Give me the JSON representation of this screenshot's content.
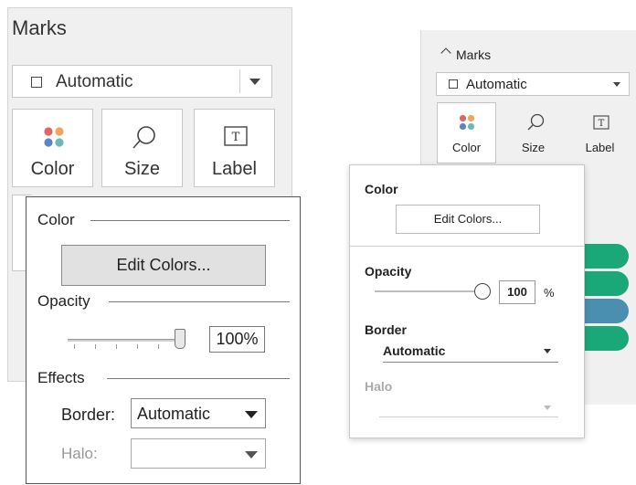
{
  "left": {
    "title": "Marks",
    "mark_type": "Automatic",
    "cards": [
      {
        "label": "Color",
        "icon": "color-dots-icon"
      },
      {
        "label": "Size",
        "icon": "size-lasso-icon"
      },
      {
        "label": "Label",
        "icon": "label-t-icon"
      }
    ],
    "popup": {
      "color_heading": "Color",
      "edit_colors": "Edit Colors...",
      "opacity_heading": "Opacity",
      "opacity_value": "100%",
      "opacity_level": 1.0,
      "effects_heading": "Effects",
      "border_label": "Border:",
      "border_value": "Automatic",
      "halo_label": "Halo:",
      "halo_value": ""
    }
  },
  "right": {
    "title": "Marks",
    "mark_type": "Automatic",
    "cards": [
      {
        "label": "Color",
        "icon": "color-dots-icon"
      },
      {
        "label": "Size",
        "icon": "size-lasso-icon"
      },
      {
        "label": "Label",
        "icon": "label-t-icon"
      }
    ],
    "popup": {
      "color_heading": "Color",
      "edit_colors": "Edit Colors...",
      "opacity_heading": "Opacity",
      "opacity_value": "100",
      "opacity_unit": "%",
      "opacity_level": 1.0,
      "border_heading": "Border",
      "border_value": "Automatic",
      "halo_heading": "Halo",
      "halo_value": ""
    },
    "bar_colors": [
      "#1aa878",
      "#1aa878",
      "#4a8fb0",
      "#1aa878"
    ]
  },
  "colors": {
    "dot_red": "#e06666",
    "dot_orange": "#f0a55a",
    "dot_blue": "#5b86c5",
    "dot_teal": "#6cb7b8"
  }
}
